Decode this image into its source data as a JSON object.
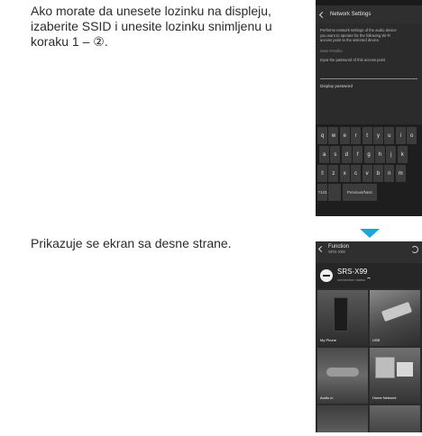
{
  "instructions": {
    "step1": "Ako morate da unesete lozinku na displeju, izaberite SSID i unesite lozinku snimljenu u koraku 1 – ②.",
    "step2": "Prikazuje se ekran sa desne strane."
  },
  "screen1": {
    "title": "Network Settings",
    "description_lines": [
      "Performs network settings of the audio device",
      "you want to operate for the following Wi-Fi",
      "access point to the selected device."
    ],
    "ssid": "www-5Yadiru",
    "prompt": "Input the password of this access point",
    "display_password": "Display password",
    "keyboard_rows": [
      [
        "q",
        "w",
        "e",
        "r",
        "t",
        "y",
        "u",
        "i",
        "o"
      ],
      [
        "a",
        "s",
        "d",
        "f",
        "g",
        "h",
        "j",
        "k"
      ],
      [
        "⇧",
        "z",
        "x",
        "c",
        "v",
        "b",
        "n",
        "m"
      ]
    ],
    "keyboard_bottom": [
      "?123",
      "",
      "Previous/Next"
    ]
  },
  "arrow_color": "#1aa6d9",
  "screen2": {
    "title": "Function",
    "subtitle": "SRS-X99",
    "device_name": "SRS-X99",
    "device_status": "connection status",
    "tiles": [
      "My Phone",
      "USB",
      "Audio in",
      "Home Network",
      "",
      ""
    ]
  }
}
